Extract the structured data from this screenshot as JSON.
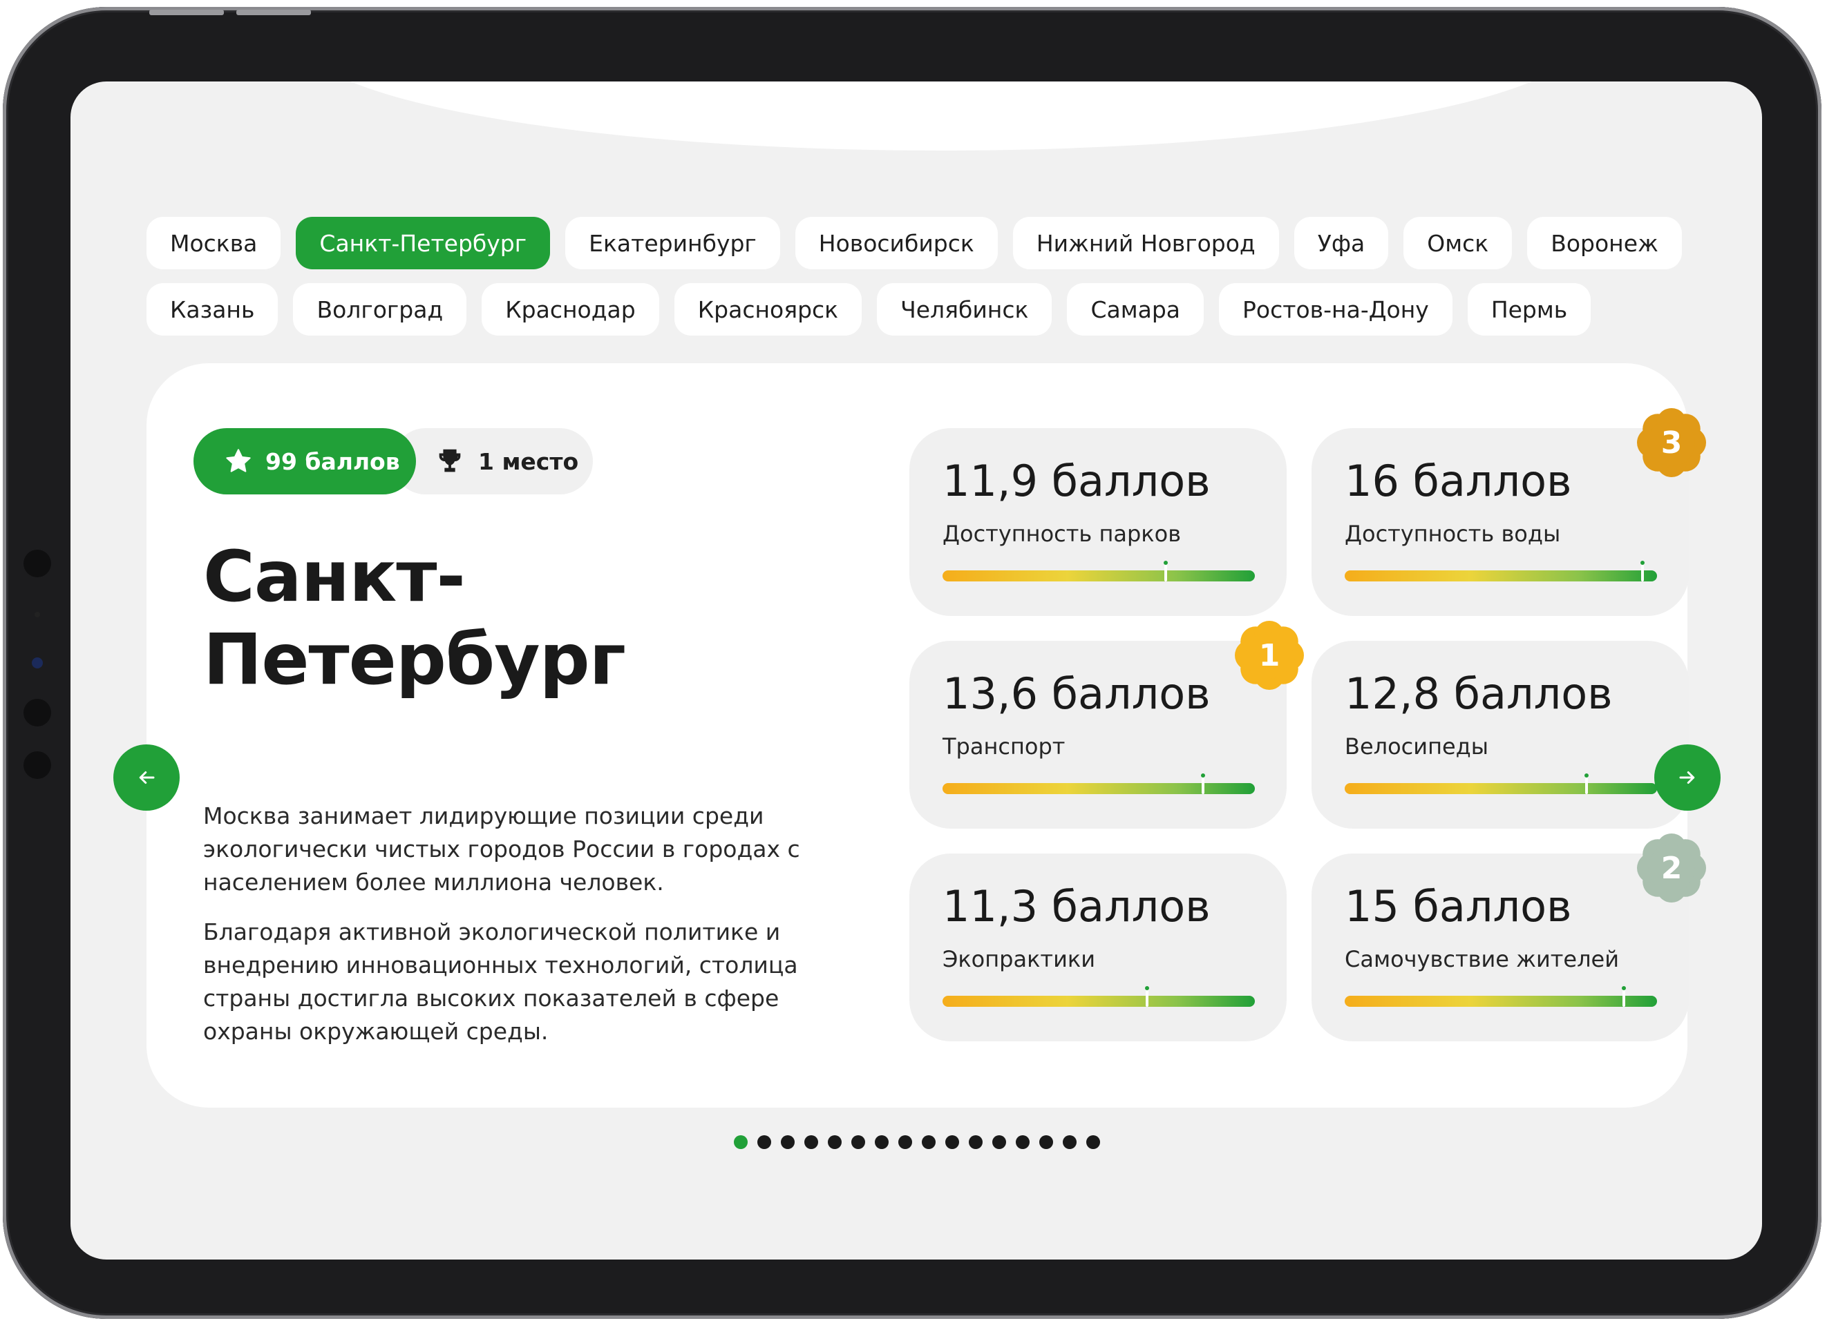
{
  "cities_row1": [
    "Москва",
    "Санкт-Петербург",
    "Екатеринбург",
    "Новосибирск",
    "Нижний Новгород",
    "Уфа",
    "Омск",
    "Воронеж"
  ],
  "cities_row2": [
    "Казань",
    "Волгоград",
    "Краснодар",
    "Красноярск",
    "Челябинск",
    "Самара",
    "Ростов-на-Дону",
    "Пермь"
  ],
  "active_city": "Санкт-Петербург",
  "card": {
    "score_badge": "99 баллов",
    "place_badge": "1 место",
    "title": "Санкт-Петербург",
    "paragraph1": "Москва занимает лидирующие позиции среди экологически чистых городов России в городах с населением более миллиона человек.",
    "paragraph2": "Благодаря активной экологической политике и внедрению инновационных технологий, столица страны достигла высоких показателей в сфере охраны окружающей среды."
  },
  "metrics": [
    {
      "value": "11,9 баллов",
      "label": "Доступность парков",
      "level": 0.71,
      "rank": ""
    },
    {
      "value": "16 баллов",
      "label": "Доступность воды",
      "level": 0.95,
      "rank": "3"
    },
    {
      "value": "13,6 баллов",
      "label": "Транспорт",
      "level": 0.83,
      "rank": "1"
    },
    {
      "value": "12,8 баллов",
      "label": "Велосипеды",
      "level": 0.77,
      "rank": ""
    },
    {
      "value": "11,3 баллов",
      "label": "Экопрактики",
      "level": 0.65,
      "rank": ""
    },
    {
      "value": "15 баллов",
      "label": "Самочувствие жителей",
      "level": 0.89,
      "rank": "2"
    }
  ],
  "rank_colors": {
    "1": "#f7b51c",
    "2": "#a9bfae",
    "3": "#e09a17"
  },
  "icons": {
    "score": "star-icon",
    "place": "trophy-icon",
    "prev": "arrow-left-icon",
    "next": "arrow-right-icon"
  },
  "colors": {
    "accent": "#21a038"
  },
  "pagination": {
    "total": 16,
    "current": 1
  }
}
